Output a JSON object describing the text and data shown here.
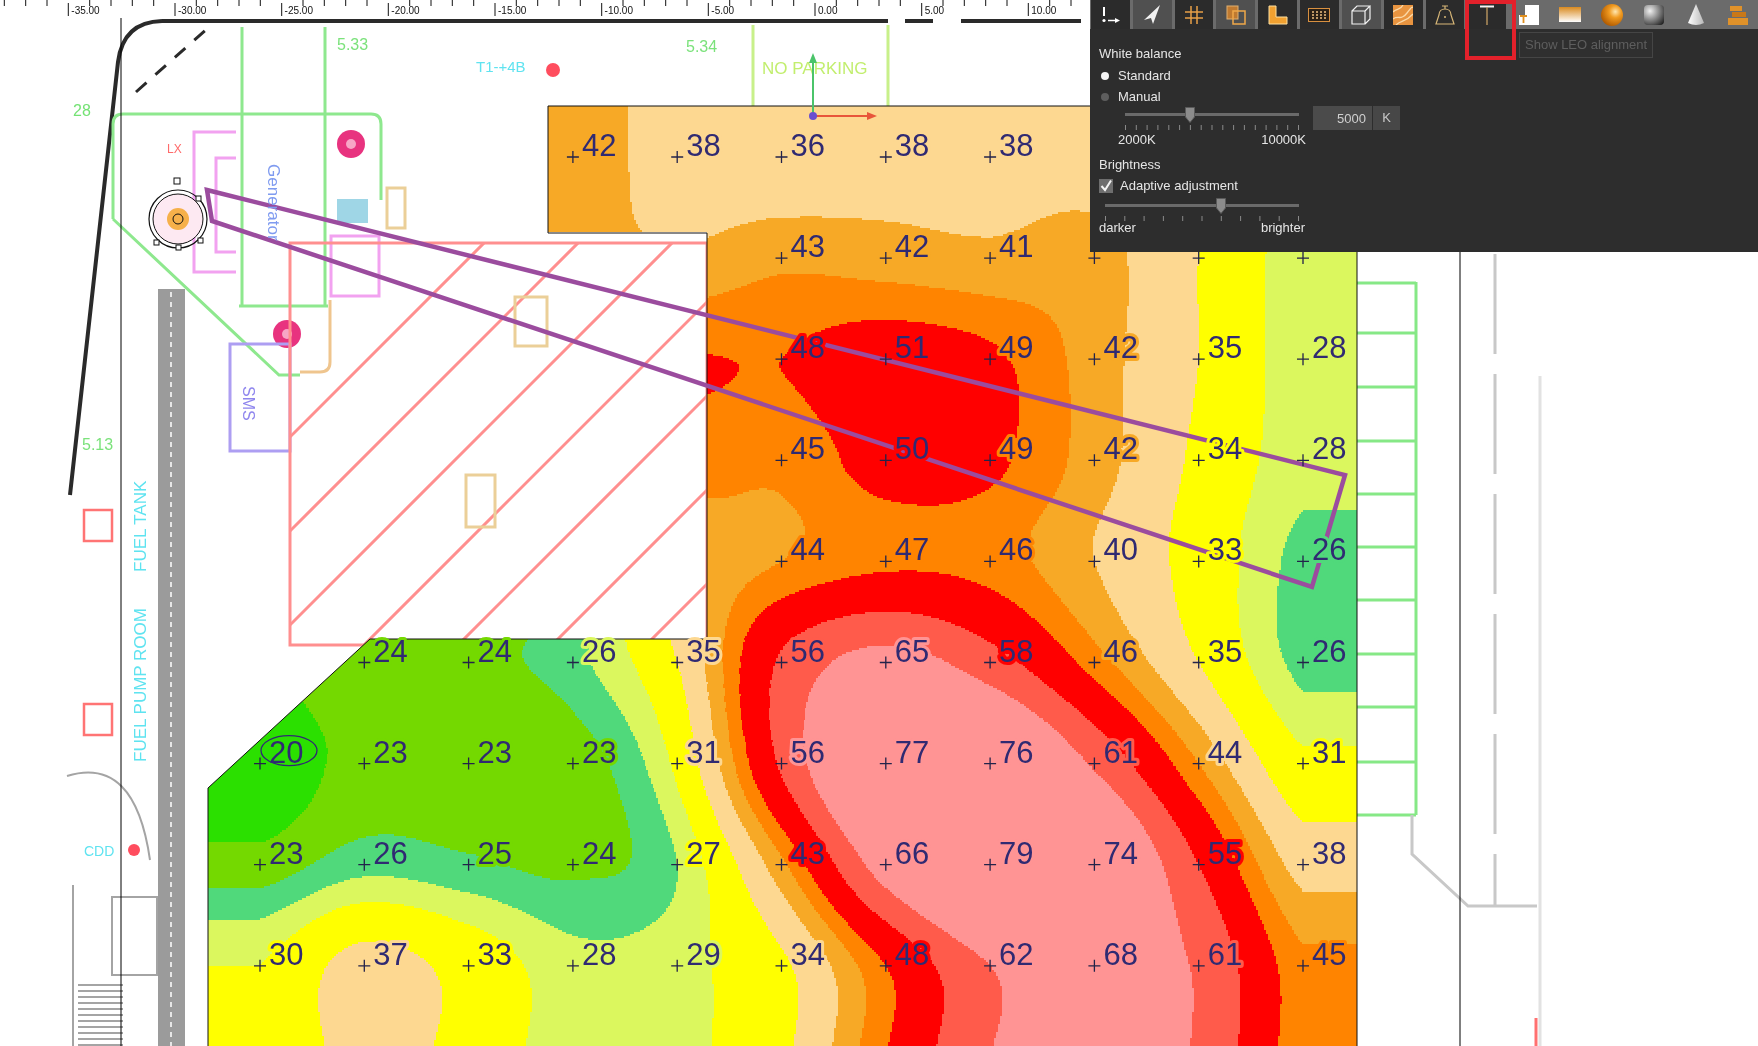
{
  "ruler": {
    "labels": [
      "-35.00",
      "-30.00",
      "-25.00",
      "-20.00",
      "-15.00",
      "-10.00",
      "-5.00",
      "0.00",
      "5.00",
      "10.00"
    ]
  },
  "plan_labels": [
    "28",
    "5.33",
    "T1-+4B",
    "5.34",
    "NO PARKING",
    "LX",
    "Generator",
    "SMS",
    "5.13",
    "FUEL TANK",
    "FUEL PUMP ROOM",
    "CDD"
  ],
  "isolux_map": {
    "rows": [
      {
        "cells": [
          null,
          null,
          null,
          {
            "value": "42",
            "circled": false
          },
          {
            "value": "38",
            "circled": false
          },
          {
            "value": "36",
            "circled": false
          },
          {
            "value": "38",
            "circled": false
          },
          {
            "value": "38",
            "circled": false
          },
          null,
          null,
          null
        ]
      },
      {
        "cells": [
          null,
          null,
          null,
          null,
          null,
          {
            "value": "43",
            "circled": false
          },
          {
            "value": "42",
            "circled": false
          },
          {
            "value": "41",
            "circled": false
          },
          {
            "circled": false
          },
          {
            "circled": false
          },
          {
            "circled": false
          }
        ]
      },
      {
        "cells": [
          null,
          null,
          null,
          null,
          null,
          {
            "value": "48",
            "circled": false
          },
          {
            "value": "51",
            "circled": false
          },
          {
            "value": "49",
            "circled": false
          },
          {
            "value": "42",
            "circled": false
          },
          {
            "value": "35",
            "circled": false
          },
          {
            "value": "28",
            "circled": false
          }
        ]
      },
      {
        "cells": [
          null,
          null,
          null,
          null,
          null,
          {
            "value": "45",
            "circled": false
          },
          {
            "value": "50",
            "circled": false
          },
          {
            "value": "49",
            "circled": false
          },
          {
            "value": "42",
            "circled": false
          },
          {
            "value": "34",
            "circled": false
          },
          {
            "value": "28",
            "circled": false
          }
        ]
      },
      {
        "cells": [
          null,
          null,
          null,
          null,
          null,
          {
            "value": "44",
            "circled": false
          },
          {
            "value": "47",
            "circled": false
          },
          {
            "value": "46",
            "circled": false
          },
          {
            "value": "40",
            "circled": false
          },
          {
            "value": "33",
            "circled": false
          },
          {
            "value": "26",
            "circled": false
          }
        ]
      },
      {
        "cells": [
          null,
          {
            "value": "24",
            "circled": false
          },
          {
            "value": "24",
            "circled": false
          },
          {
            "value": "26",
            "circled": false
          },
          {
            "value": "35",
            "circled": false
          },
          {
            "value": "56",
            "circled": false
          },
          {
            "value": "65",
            "circled": false
          },
          {
            "value": "58",
            "circled": false
          },
          {
            "value": "46",
            "circled": false
          },
          {
            "value": "35",
            "circled": false
          },
          {
            "value": "26",
            "circled": false
          }
        ]
      },
      {
        "cells": [
          {
            "value": "20",
            "circled": true
          },
          {
            "value": "23",
            "circled": false
          },
          {
            "value": "23",
            "circled": false
          },
          {
            "value": "23",
            "circled": false
          },
          {
            "value": "31",
            "circled": false
          },
          {
            "value": "56",
            "circled": false
          },
          {
            "value": "77",
            "circled": false
          },
          {
            "value": "76",
            "circled": false
          },
          {
            "value": "61",
            "circled": false
          },
          {
            "value": "44",
            "circled": false
          },
          {
            "value": "31",
            "circled": false
          }
        ]
      },
      {
        "cells": [
          {
            "value": "23",
            "circled": false
          },
          {
            "value": "26",
            "circled": false
          },
          {
            "value": "25",
            "circled": false
          },
          {
            "value": "24",
            "circled": false
          },
          {
            "value": "27",
            "circled": false
          },
          {
            "value": "43",
            "circled": false
          },
          {
            "value": "66",
            "circled": false
          },
          {
            "value": "79",
            "circled": false
          },
          {
            "value": "74",
            "circled": false
          },
          {
            "value": "55",
            "circled": false
          },
          {
            "value": "38",
            "circled": false
          }
        ]
      },
      {
        "cells": [
          {
            "value": "30",
            "circled": false
          },
          {
            "value": "37",
            "circled": false
          },
          {
            "value": "33",
            "circled": false
          },
          {
            "value": "28",
            "circled": false
          },
          {
            "value": "29",
            "circled": false
          },
          {
            "value": "34",
            "circled": false
          },
          {
            "value": "48",
            "circled": false
          },
          {
            "value": "62",
            "circled": false
          },
          {
            "value": "68",
            "circled": false
          },
          {
            "value": "61",
            "circled": false
          },
          {
            "value": "45",
            "circled": false
          }
        ]
      }
    ]
  },
  "toolbar": {
    "toggle_buttons": [
      {
        "kind": "axes",
        "on": true
      },
      {
        "kind": "pointer",
        "on": false
      },
      {
        "kind": "grid",
        "on": true
      },
      {
        "kind": "copy",
        "on": false
      },
      {
        "kind": "corner",
        "on": true
      },
      {
        "kind": "dots",
        "on": true
      },
      {
        "kind": "cube",
        "on": false
      },
      {
        "kind": "texture",
        "on": true
      },
      {
        "kind": "lamp",
        "on": true
      },
      {
        "kind": "tbar",
        "on": true
      }
    ],
    "view_buttons": [
      {
        "kind": "sheet"
      },
      {
        "kind": "gradient"
      },
      {
        "kind": "sphere"
      },
      {
        "kind": "shaded"
      },
      {
        "kind": "cone"
      },
      {
        "kind": "stack"
      }
    ]
  },
  "tooltip": {
    "text": "Show LEO alignment"
  },
  "white_balance": {
    "title": "White balance",
    "options": [
      {
        "label": "Standard",
        "selected": true
      },
      {
        "label": "Manual",
        "selected": false
      }
    ],
    "slider": {
      "level": 0.375,
      "min_label": "2000K",
      "max_label": "10000K"
    },
    "input": {
      "value": "5000",
      "unit": "K"
    }
  },
  "brightness": {
    "title": "Brightness",
    "checkbox": {
      "label": "Adaptive adjustment",
      "checked": true
    },
    "slider": {
      "level": 0.6,
      "min_label": "darker",
      "max_label": "brighter"
    }
  }
}
